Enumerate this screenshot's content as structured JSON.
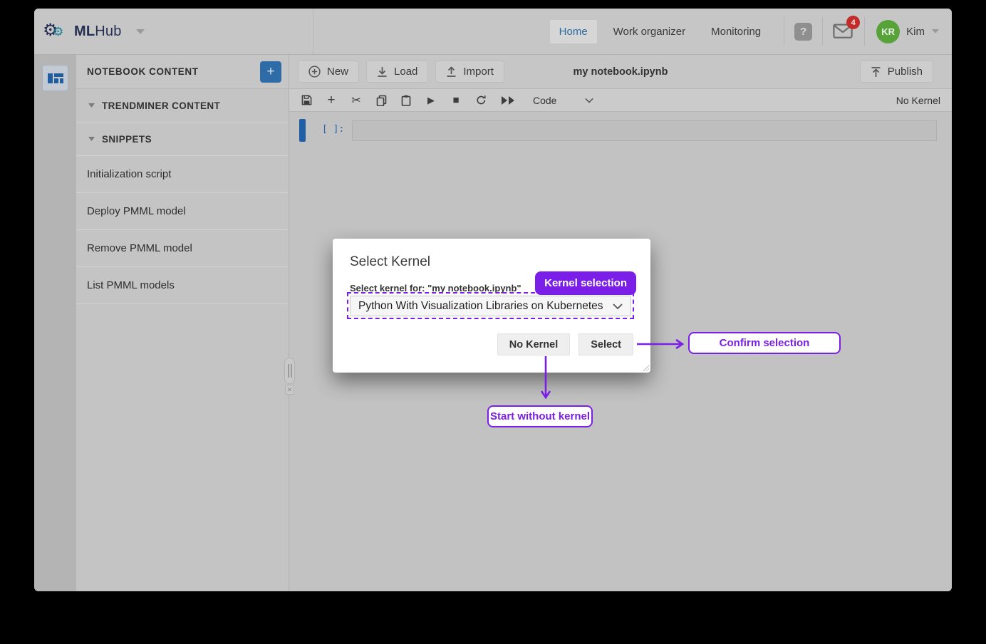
{
  "brand": {
    "name_bold": "ML",
    "name_light": "Hub"
  },
  "topnav": {
    "items": [
      {
        "label": "Home",
        "active": true
      },
      {
        "label": "Work organizer",
        "active": false
      },
      {
        "label": "Monitoring",
        "active": false
      }
    ],
    "help_glyph": "?",
    "notifications": "4",
    "user_initials": "KR",
    "user_name": "Kim"
  },
  "sidebar": {
    "title": "NOTEBOOK CONTENT",
    "add_button": "+",
    "sections": [
      "TRENDMINER CONTENT",
      "SNIPPETS"
    ],
    "items": [
      "Initialization script",
      "Deploy PMML model",
      "Remove PMML model",
      "List PMML models"
    ]
  },
  "notebook": {
    "new_label": "New",
    "load_label": "Load",
    "import_label": "Import",
    "filename": "my notebook.ipynb",
    "publish_label": "Publish",
    "cell_type": "Code",
    "kernel_status": "No Kernel",
    "cell_prompt": "[ ]:",
    "toolbar_icons": [
      "save",
      "add-cell",
      "cut",
      "copy",
      "paste",
      "run",
      "stop",
      "restart",
      "run-all"
    ]
  },
  "modal": {
    "title": "Select Kernel",
    "label": "Select kernel for: \"my notebook.ipynb\"",
    "kernel_option": "Python With Visualization Libraries on Kubernetes",
    "no_kernel_label": "No Kernel",
    "select_label": "Select"
  },
  "annotations": {
    "kernel_selection": "Kernel selection",
    "confirm_selection": "Confirm selection",
    "start_without_kernel": "Start without kernel"
  },
  "colors": {
    "annotation_purple": "#7b1fe8",
    "brand_navy": "#252f52",
    "accent_blue": "#2e6ca8",
    "link_blue": "#2b6ba3",
    "avatar_green": "#57a339",
    "badge_red": "#c32a2a",
    "cell_selection_blue": "#1f5fa8"
  }
}
